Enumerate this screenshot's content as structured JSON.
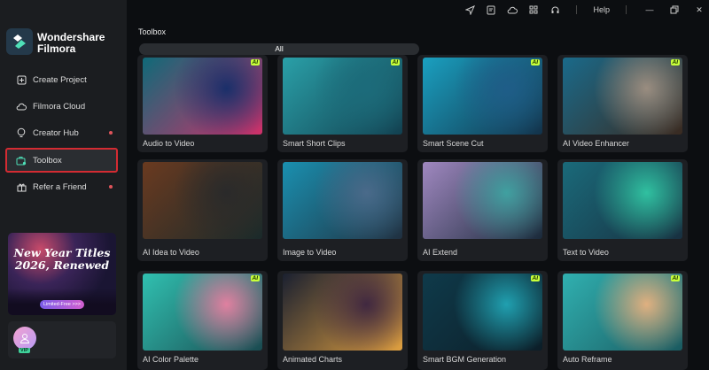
{
  "app": {
    "brand_line1": "Wondershare",
    "brand_line2": "Filmora"
  },
  "sidebar": {
    "items": [
      {
        "label": "Create Project",
        "icon": "plus-square-icon",
        "dot": false
      },
      {
        "label": "Filmora Cloud",
        "icon": "cloud-icon",
        "dot": false
      },
      {
        "label": "Creator Hub",
        "icon": "bulb-icon",
        "dot": true
      },
      {
        "label": "Toolbox",
        "icon": "toolbox-icon",
        "dot": false,
        "active": true
      },
      {
        "label": "Refer a Friend",
        "icon": "gift-icon",
        "dot": true
      }
    ],
    "promo": {
      "title_line1": "New Year Titles",
      "title_line2": "2026, Renewed",
      "button": "Limited-Free >>>"
    },
    "user": {
      "badge": "VIP"
    }
  },
  "topbar": {
    "help": "Help"
  },
  "main": {
    "title": "Toolbox",
    "tab": "All",
    "tools": [
      {
        "label": "Audio to Video",
        "ai": "AI",
        "colors": [
          "#0f6a78",
          "#1a2f6a",
          "#d0306a"
        ]
      },
      {
        "label": "Smart Short Clips",
        "ai": "AI",
        "colors": [
          "#2aa0a8",
          "#1c6b7a",
          "#124050"
        ]
      },
      {
        "label": "Smart Scene Cut",
        "ai": "AI",
        "colors": [
          "#1aa0c0",
          "#1f5d88",
          "#13324a"
        ]
      },
      {
        "label": "AI Video Enhancer",
        "ai": "AI",
        "colors": [
          "#1a6a8a",
          "#9a8d80",
          "#3a2a20"
        ]
      },
      {
        "label": "AI Idea to Video",
        "ai": "",
        "colors": [
          "#6a3a20",
          "#2a2a2a",
          "#1a2a2a"
        ]
      },
      {
        "label": "Image to Video",
        "ai": "",
        "colors": [
          "#1a90b0",
          "#4a6a8a",
          "#203040"
        ]
      },
      {
        "label": "AI Extend",
        "ai": "",
        "colors": [
          "#a088c0",
          "#40a0a0",
          "#1a2a3a"
        ]
      },
      {
        "label": "Text to Video",
        "ai": "",
        "colors": [
          "#1a6a7a",
          "#30c0a0",
          "#183040"
        ]
      },
      {
        "label": "AI Color Palette",
        "ai": "AI",
        "colors": [
          "#30c0b0",
          "#e080a0",
          "#1a4a50"
        ]
      },
      {
        "label": "Animated Charts",
        "ai": "",
        "colors": [
          "#1a2030",
          "#402840",
          "#e0a040"
        ]
      },
      {
        "label": "Smart BGM Generation",
        "ai": "AI",
        "colors": [
          "#0f3a4a",
          "#20a0b0",
          "#0c1e28"
        ]
      },
      {
        "label": "Auto Reframe",
        "ai": "AI",
        "colors": [
          "#30b0b0",
          "#e0b080",
          "#1a5a60"
        ]
      }
    ]
  }
}
